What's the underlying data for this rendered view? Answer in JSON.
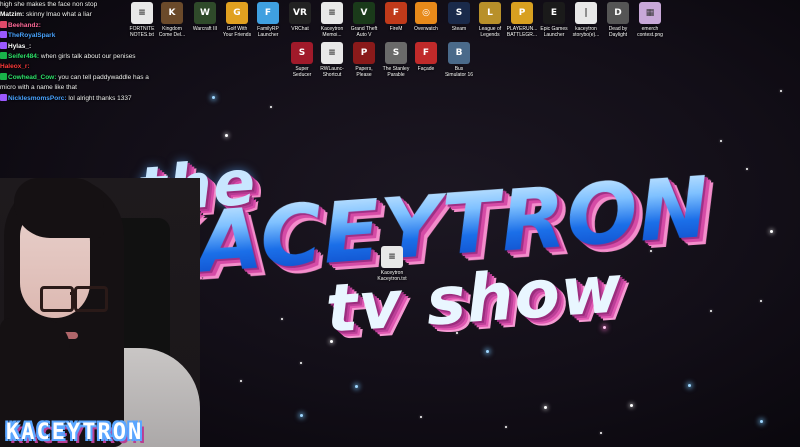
{
  "chat": [
    {
      "badges": [],
      "user": "",
      "text": "high she makes the  face non stop",
      "user_color": "#ffffff"
    },
    {
      "badges": [],
      "user": "Matzim:",
      "text": "skinny lmao what a liar",
      "user_color": "#ffffff"
    },
    {
      "badges": [
        "#e04a6a"
      ],
      "user": "Beehandz:",
      "text": "",
      "user_color": "#ff6a9a"
    },
    {
      "badges": [
        "#9b59ff"
      ],
      "user": "TheRoyalSpark",
      "text": "",
      "user_color": "#4aa3ff"
    },
    {
      "badges": [
        "#9b59ff"
      ],
      "user": "Hylas_:",
      "text": "",
      "user_color": "#ffffff"
    },
    {
      "badges": [
        "#19b34a"
      ],
      "user": "Seifer484:",
      "text": "when girls talk about our penises",
      "user_color": "#2ee06a"
    },
    {
      "badges": [],
      "user": "Haleox_r:",
      "text": "",
      "user_color": "#ff3b3b"
    },
    {
      "badges": [
        "#19b34a"
      ],
      "user": "Cowhead_Cow:",
      "text": "you can tell paddywaddle has a",
      "user_color": "#2ee06a"
    },
    {
      "badges": [],
      "user": "",
      "text": "micro with a name like that",
      "user_color": "#ffffff"
    },
    {
      "badges": [
        "#9b59ff"
      ],
      "user": "NicklesmomsPorc:",
      "text": "lol alright thanks 1337",
      "user_color": "#4aa3ff"
    }
  ],
  "desktop_icons": [
    {
      "name": "fortnite-notes-icon",
      "label": "FORTNITE\nNOTES.txt",
      "glyph": "≡",
      "color": "#e8e8e8"
    },
    {
      "name": "kingdom-come-icon",
      "label": "Kingdom\nCome Del...",
      "glyph": "K",
      "color": "#6b4a2a"
    },
    {
      "name": "warcraft-icon",
      "label": "Warcraft III",
      "glyph": "W",
      "color": "#2f4a2a"
    },
    {
      "name": "golf-friends-icon",
      "label": "Golf With\nYour Friends",
      "glyph": "G",
      "color": "#e0a020"
    },
    {
      "name": "familyrp-icon",
      "label": "FamilyRP\nLauncher",
      "glyph": "F",
      "color": "#3fa0e0"
    },
    {
      "name": "vrchat-icon",
      "label": "VRChat",
      "glyph": "VR",
      "color": "#222222"
    },
    {
      "name": "kaceytron-memoir-icon",
      "label": "Kaceytron\nMemoi...",
      "glyph": "≡",
      "color": "#e8e8e8"
    },
    {
      "name": "gta-icon",
      "label": "Grand Theft\nAuto V",
      "glyph": "V",
      "color": "#1a3a1a"
    },
    {
      "name": "firefall-icon",
      "label": "FireM",
      "glyph": "F",
      "color": "#c03a1a"
    },
    {
      "name": "overwatch-icon",
      "label": "Overwatch",
      "glyph": "◎",
      "color": "#e88a1a"
    },
    {
      "name": "steam-icon",
      "label": "Steam",
      "glyph": "S",
      "color": "#1a2a4a"
    },
    {
      "name": "league-icon",
      "label": "League of\nLegends",
      "glyph": "L",
      "color": "#b8902a"
    },
    {
      "name": "pubg-icon",
      "label": "PLAYERUN...\nBATTLEGR...",
      "glyph": "P",
      "color": "#d8a020"
    },
    {
      "name": "epic-games-icon",
      "label": "Epic Games\nLauncher",
      "glyph": "E",
      "color": "#1a1a1a"
    },
    {
      "name": "kaceytron-story-icon",
      "label": "kaceytron\nstorybo(e)...",
      "glyph": "|",
      "color": "#e8e8e8"
    },
    {
      "name": "dead-by-daylight-icon",
      "label": "Dead by\nDaylight",
      "glyph": "D",
      "color": "#555555"
    },
    {
      "name": "emerch-png-icon",
      "label": "emerch\ncontest.png",
      "glyph": "▦",
      "color": "#c8a8d8"
    },
    {
      "name": "super-seducer-icon",
      "label": "Super\nSeducer",
      "glyph": "S",
      "color": "#a01a2a"
    },
    {
      "name": "rwlauncher-shortcut-icon",
      "label": "RWLaunc-\nShortcut",
      "glyph": "≡",
      "color": "#e8e8e8"
    },
    {
      "name": "papers-please-icon",
      "label": "Papers,\nPlease",
      "glyph": "P",
      "color": "#8a1a1a"
    },
    {
      "name": "stanley-parable-icon",
      "label": "The Stanley\nParable",
      "glyph": "S",
      "color": "#6a6a6a"
    },
    {
      "name": "facade-icon",
      "label": "Façade",
      "glyph": "F",
      "color": "#c02a2a"
    },
    {
      "name": "bus-simulator-icon",
      "label": "Bus\nSimulator 16",
      "glyph": "B",
      "color": "#4a6a8a"
    },
    {
      "name": "kaceytron-file-icon",
      "label": "Kaceytron\nKaceytron.txt",
      "glyph": "≡",
      "color": "#e8e8e8"
    }
  ],
  "logo": {
    "line1": "the",
    "line2": "KACEYTRON",
    "line3": "tv show"
  },
  "nameplate": "KACEYTRON"
}
